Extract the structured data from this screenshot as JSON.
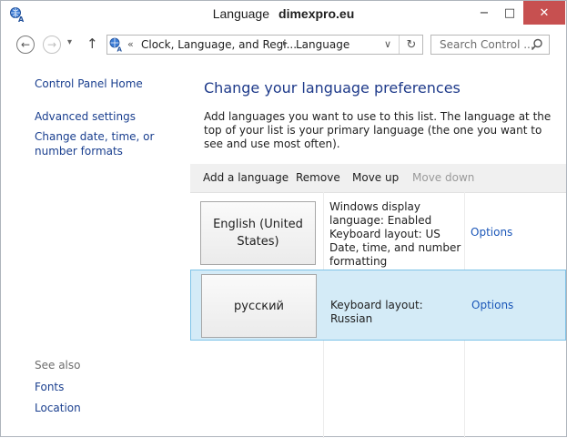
{
  "window": {
    "title": "Language",
    "brand": "dimexpro.eu",
    "minimize_label": "−",
    "maximize_label": "□",
    "close_label": "✕"
  },
  "nav": {
    "back_label": "←",
    "forward_label": "→",
    "recent_label": "▾",
    "up_label": "↑",
    "address_chevron": "«",
    "breadcrumb": [
      "Clock, Language, and Regi...",
      "Language"
    ],
    "breadcrumb_separator": "▸",
    "dropdown_label": "∨",
    "refresh_label": "↻",
    "search_placeholder": "Search Control ..."
  },
  "sidebar": {
    "home": "Control Panel Home",
    "advanced": "Advanced settings",
    "datetime": "Change date, time, or number formats",
    "see_also": "See also",
    "fonts": "Fonts",
    "location": "Location"
  },
  "main": {
    "title": "Change your language preferences",
    "intro": "Add languages you want to use to this list. The language at the top of your list is your primary language (the one you want to see and use most often).",
    "toolbar": {
      "add": "Add a language",
      "remove": "Remove",
      "move_up": "Move up",
      "move_down": "Move down"
    },
    "languages": [
      {
        "name": "English (United States)",
        "description": "Windows display language: Enabled Keyboard layout: US Date, time, and number formatting",
        "options": "Options",
        "selected": false
      },
      {
        "name": "русский",
        "description": "Keyboard layout: Russian",
        "options": "Options",
        "selected": true
      }
    ]
  },
  "colors": {
    "link": "#1a3f8f",
    "title": "#1e3a8a",
    "selection_bg": "#d4ebf7",
    "selection_border": "#7ec3e8",
    "close_button": "#c75050"
  }
}
